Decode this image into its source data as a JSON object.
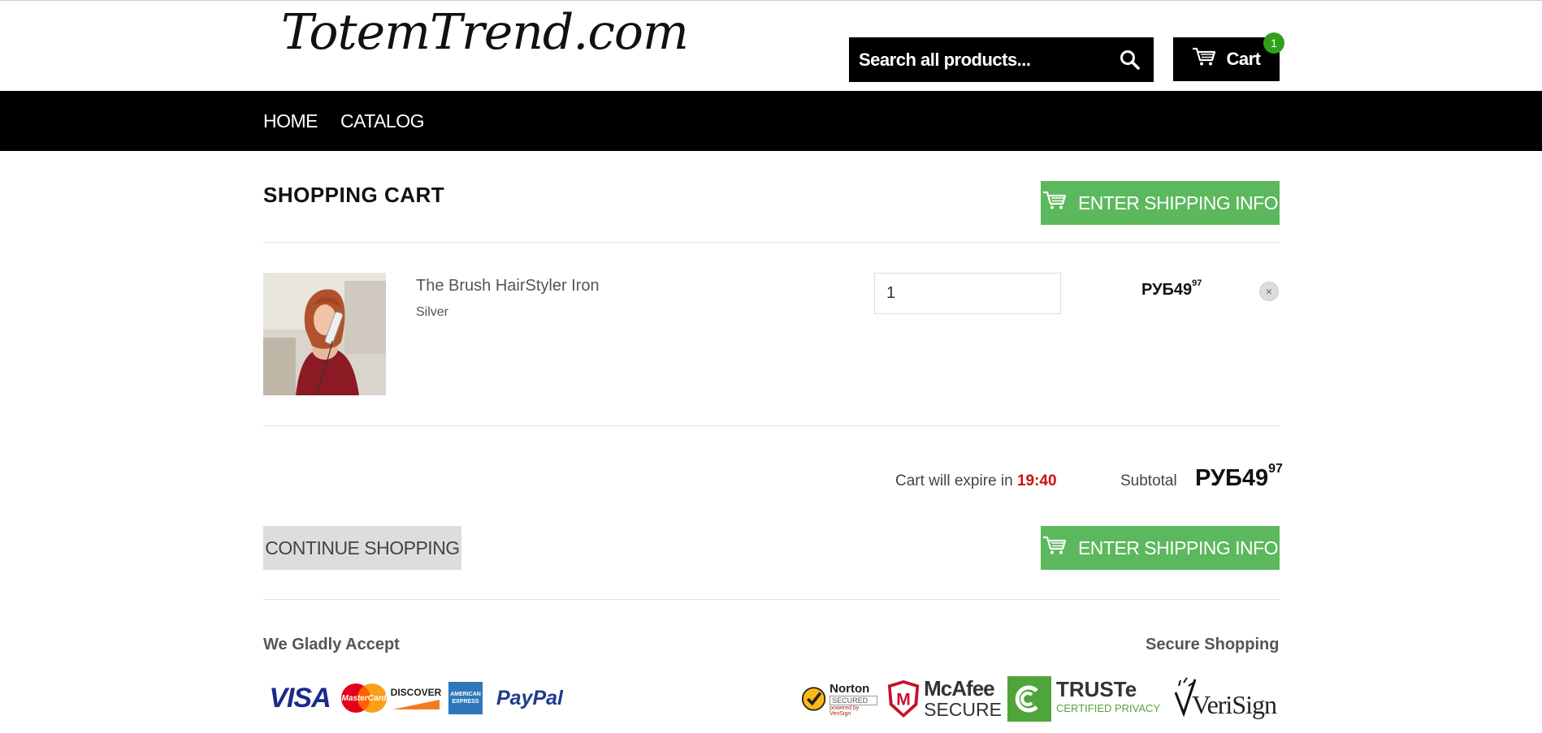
{
  "header": {
    "logo_text": "TotemTrend.com",
    "search_placeholder": "Search all products...",
    "cart_label": "Cart",
    "cart_count": "1"
  },
  "nav": {
    "items": [
      "HOME",
      "CATALOG"
    ]
  },
  "cart": {
    "title": "SHOPPING CART",
    "checkout_label": "ENTER SHIPPING INFO",
    "item": {
      "name": "The Brush HairStyler Iron",
      "variant": "Silver",
      "quantity": "1",
      "price_main": "РУБ49",
      "price_cents": "97",
      "remove_symbol": "×"
    },
    "expire_text": "Cart will expire in",
    "expire_time": "19:40",
    "subtotal_label": "Subtotal",
    "subtotal_main": "РУБ49",
    "subtotal_cents": "97",
    "continue_label": "CONTINUE SHOPPING"
  },
  "footer": {
    "accept_heading": "We Gladly Accept",
    "secure_heading": "Secure Shopping",
    "payment_logos": [
      "VISA",
      "MasterCard",
      "DISCOVER",
      "AMERICAN EXPRESS",
      "PayPal"
    ],
    "norton": {
      "name": "Norton",
      "sub": "SECURED",
      "powered": "powered by VeriSign"
    },
    "mcafee": {
      "name": "McAfee",
      "sub": "SECURE"
    },
    "truste": {
      "name": "TRUSTe",
      "sub": "CERTIFIED PRIVACY"
    },
    "verisign": {
      "name": "VeriSign"
    }
  },
  "colors": {
    "accent_green": "#5cb85c",
    "badge_green": "#2ea01c",
    "timer_red": "#cc1111"
  }
}
